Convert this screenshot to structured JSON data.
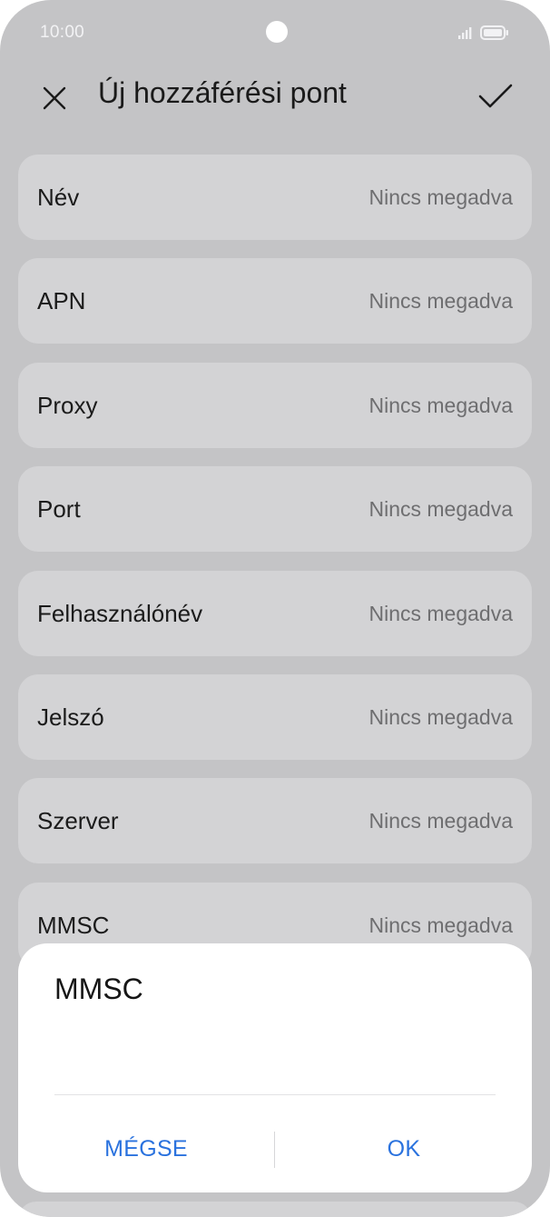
{
  "status_bar": {
    "time": "10:00"
  },
  "header": {
    "title": "Új hozzáférési pont",
    "close_icon": "close-icon",
    "confirm_icon": "check-icon"
  },
  "rows": [
    {
      "label": "Név",
      "value": "Nincs megadva"
    },
    {
      "label": "APN",
      "value": "Nincs megadva"
    },
    {
      "label": "Proxy",
      "value": "Nincs megadva"
    },
    {
      "label": "Port",
      "value": "Nincs megadva"
    },
    {
      "label": "Felhasználónév",
      "value": "Nincs megadva"
    },
    {
      "label": "Jelszó",
      "value": "Nincs megadva"
    },
    {
      "label": "Szerver",
      "value": "Nincs megadva"
    },
    {
      "label": "MMSC",
      "value": "Nincs megadva"
    }
  ],
  "dialog": {
    "title": "MMSC",
    "input_value": "",
    "cancel_label": "MÉGSE",
    "ok_label": "OK"
  },
  "colors": {
    "overlay_background": "#c4c4c6",
    "row_background": "#d3d3d5",
    "dialog_background": "#ffffff",
    "accent": "#2a72de"
  }
}
